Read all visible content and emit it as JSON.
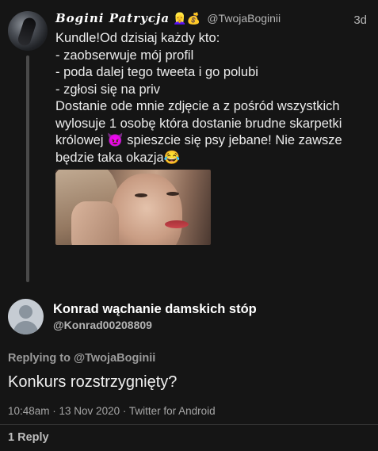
{
  "original_tweet": {
    "display_name": "Bogini Patrycja",
    "name_emoji": "👱‍♀️💰",
    "handle": "@TwojaBoginii",
    "time": "3d",
    "lines": [
      "Kundle!Od dzisiaj każdy kto:",
      "- zaobserwuje mój profil",
      "- poda dalej tego tweeta i go polubi",
      "- zgłosi się na priv",
      "Dostanie ode mnie zdjęcie a z pośród wszystkich",
      "wylosuje 1 osobę która dostanie brudne skarpetki",
      "królowej 😈 spieszcie się psy jebane! Nie zawsze",
      "będzie taka okazja😂"
    ]
  },
  "reply_tweet": {
    "display_name": "Konrad wąchanie damskich stóp",
    "handle": "@Konrad00208809",
    "replying_label": "Replying to",
    "replying_to": "@TwojaBoginii",
    "text": "Konkurs rozstrzygnięty?",
    "meta": "10:48am · 13 Nov 2020 · Twitter for Android",
    "replies_count": "1",
    "replies_label": "Reply"
  }
}
